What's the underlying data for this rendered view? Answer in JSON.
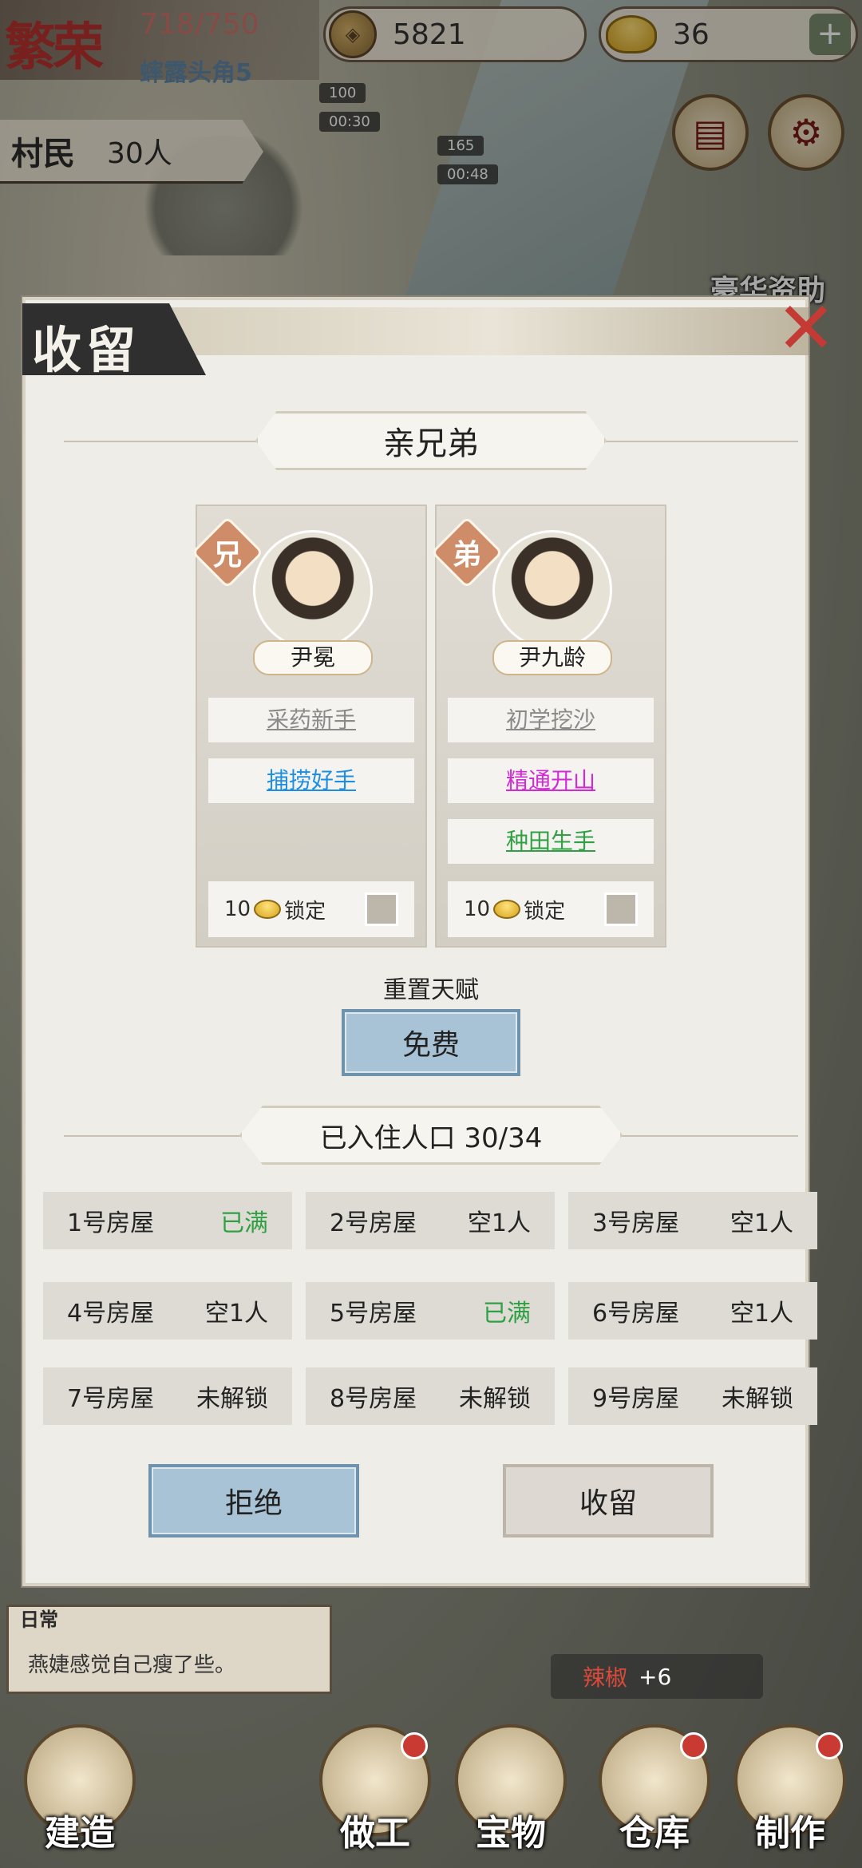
{
  "hud": {
    "logo": "繁荣",
    "population": "718/750",
    "season": "蟀露头角5",
    "copper": "5821",
    "gold": "36",
    "villagers_label": "村民",
    "villagers_count": "30人",
    "timer1_cost": "100",
    "timer1_time": "00:30",
    "timer2_cost": "165",
    "timer2_time": "00:48",
    "deluxe_label": "豪华资助"
  },
  "dialog": {
    "title": "收留",
    "relation_banner": "亲兄弟",
    "brothers": [
      {
        "badge": "兄",
        "name": "尹冕",
        "traits": [
          {
            "label": "采药新手",
            "color": "#8a8a8a"
          },
          {
            "label": "捕捞好手",
            "color": "#1e8fe0"
          }
        ],
        "lock_cost": "10",
        "lock_label": "锁定"
      },
      {
        "badge": "弟",
        "name": "尹九龄",
        "traits": [
          {
            "label": "初学挖沙",
            "color": "#8a8a8a"
          },
          {
            "label": "精通开山",
            "color": "#d22bd6"
          },
          {
            "label": "种田生手",
            "color": "#2fa043"
          }
        ],
        "lock_cost": "10",
        "lock_label": "锁定"
      }
    ],
    "reset_label": "重置天赋",
    "reset_button": "免费",
    "residents_banner": "已入住人口 30/34",
    "houses": [
      {
        "name": "1号房屋",
        "status": "已满",
        "full": true
      },
      {
        "name": "2号房屋",
        "status": "空1人",
        "full": false
      },
      {
        "name": "3号房屋",
        "status": "空1人",
        "full": false
      },
      {
        "name": "4号房屋",
        "status": "空1人",
        "full": false
      },
      {
        "name": "5号房屋",
        "status": "已满",
        "full": true
      },
      {
        "name": "6号房屋",
        "status": "空1人",
        "full": false
      },
      {
        "name": "7号房屋",
        "status": "未解锁",
        "full": false
      },
      {
        "name": "8号房屋",
        "status": "未解锁",
        "full": false
      },
      {
        "name": "9号房屋",
        "status": "未解锁",
        "full": false
      }
    ],
    "reject_button": "拒绝",
    "accept_button": "收留"
  },
  "bottom": {
    "log_tag": "日常",
    "log_text": "燕婕感觉自己瘦了些。",
    "buff_label": "辣椒",
    "buff_value": "+6",
    "nav": [
      "建造",
      "做工",
      "宝物",
      "仓库",
      "制作"
    ]
  },
  "colors": {
    "full_status": "#2fa043",
    "blue_button": "#a8c3d6",
    "close_x": "#c43a35"
  }
}
